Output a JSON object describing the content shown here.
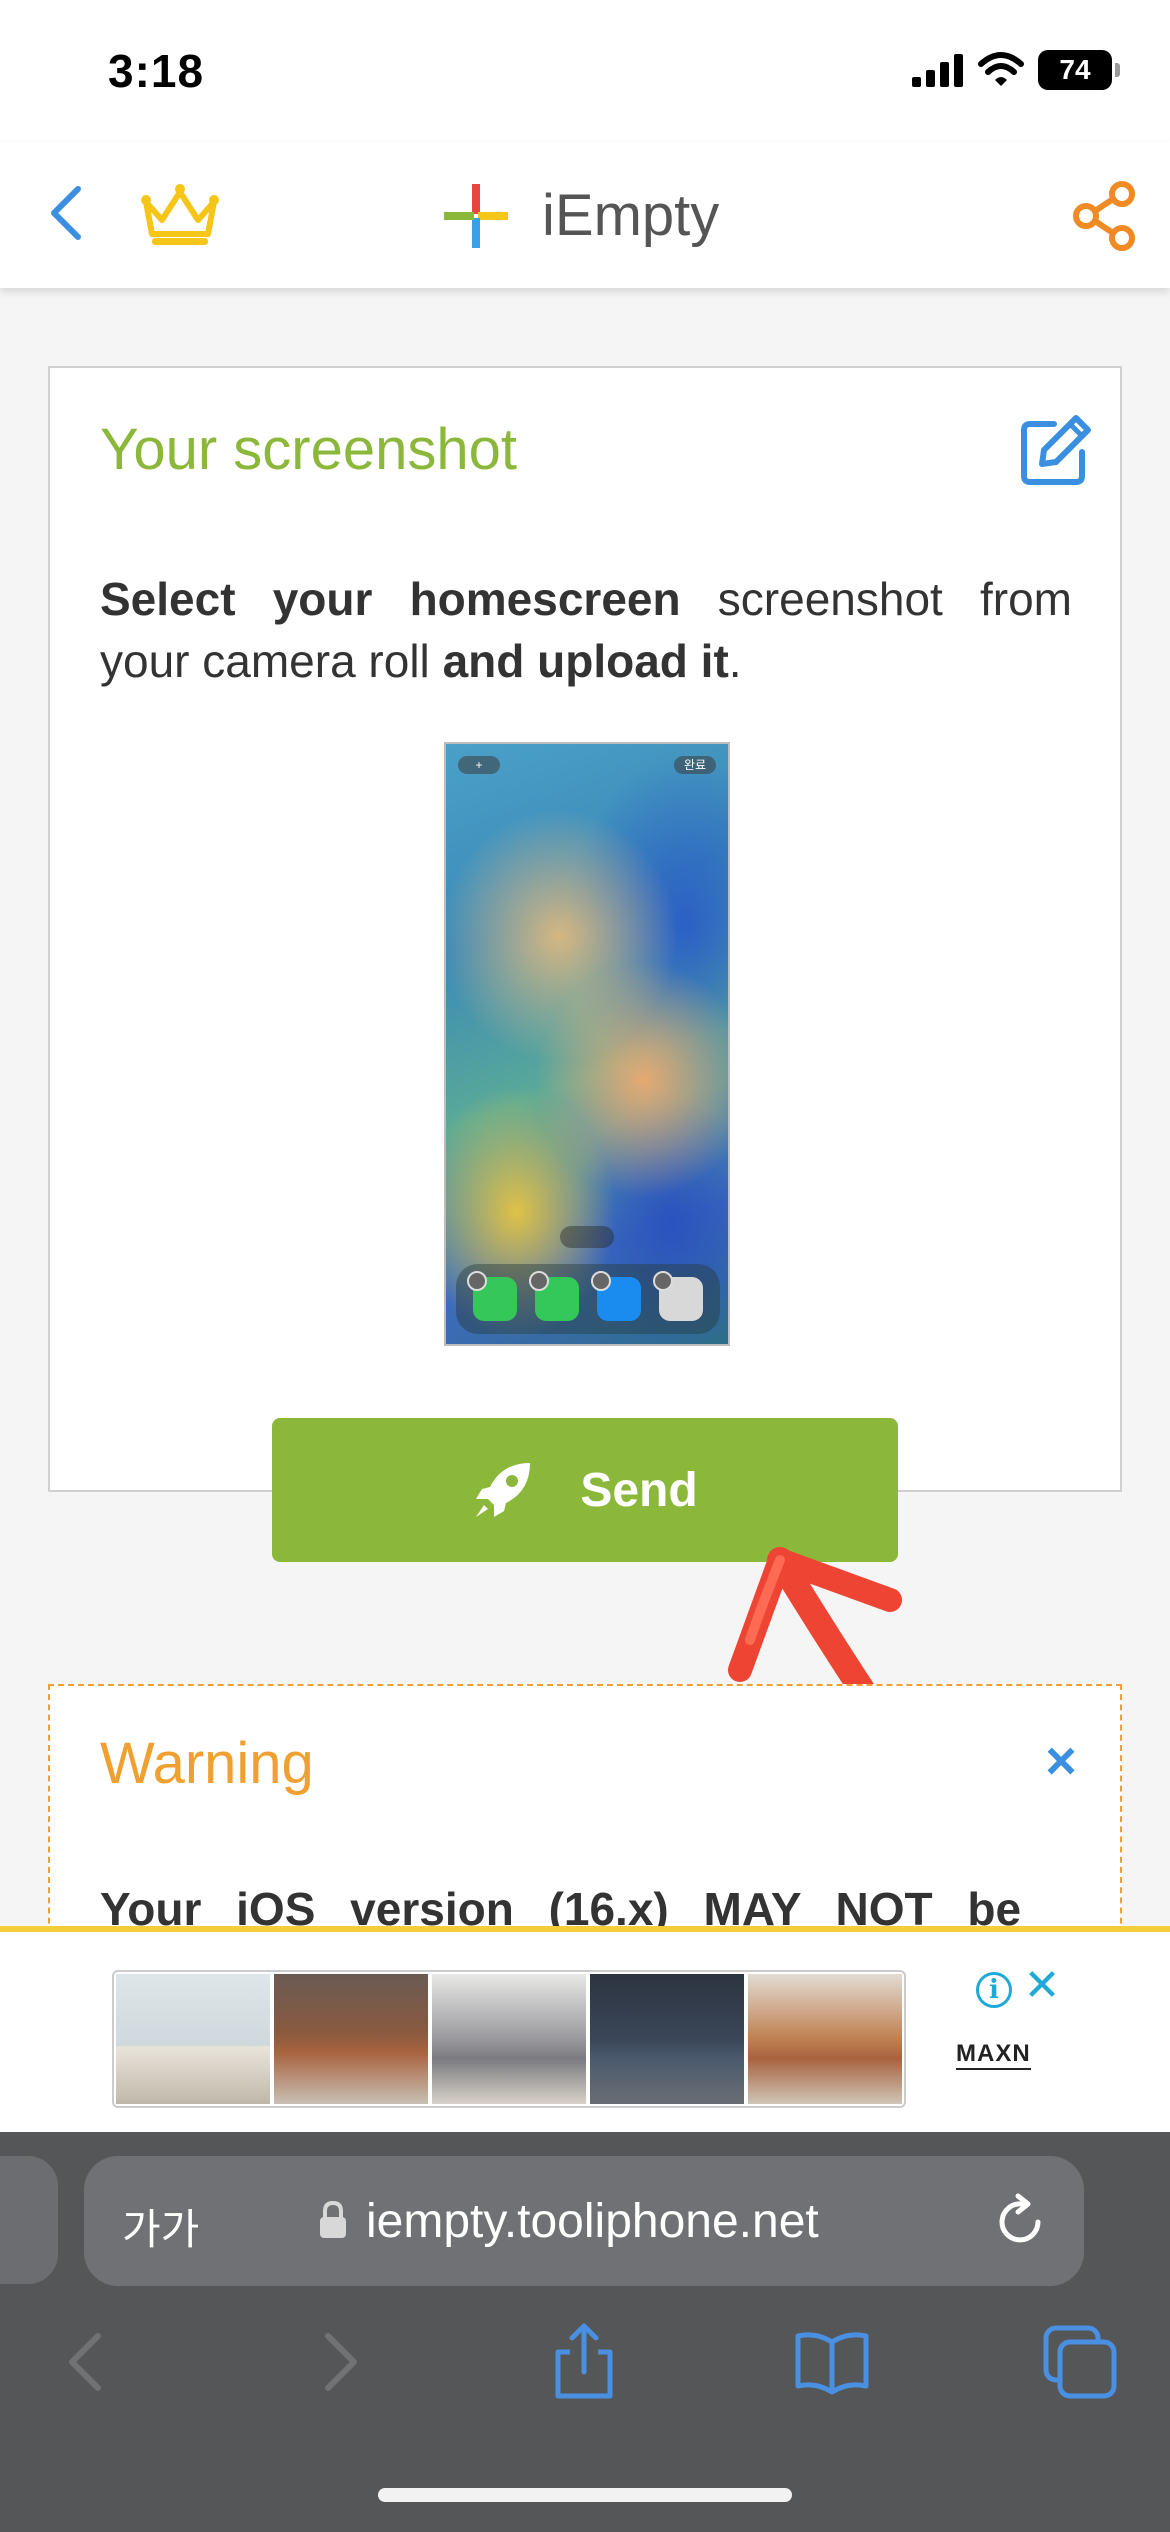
{
  "status_bar": {
    "time": "3:18",
    "battery": "74"
  },
  "header": {
    "title": "iEmpty"
  },
  "card": {
    "title": "Your screenshot",
    "text_bold_1": "Select your homescreen",
    "text_normal_1": " screenshot from your camera roll ",
    "text_bold_2": "and upload it",
    "text_normal_2": ".",
    "preview": {
      "plus_label": "+",
      "done_label": "완료"
    }
  },
  "send_button": {
    "label": "Send"
  },
  "warning": {
    "title": "Warning",
    "close": "×",
    "text": "Your iOS version (16.x) MAY NOT be"
  },
  "ad": {
    "info": "i",
    "close": "✕",
    "brand": "MAXN"
  },
  "browser": {
    "aa_label": "가가",
    "url": "iempty.tooliphone.net"
  },
  "colors": {
    "accent_green": "#8bb83a",
    "warning_orange": "#f0a030",
    "link_blue": "#3a8fe0",
    "ad_border": "#f5cd3a"
  }
}
